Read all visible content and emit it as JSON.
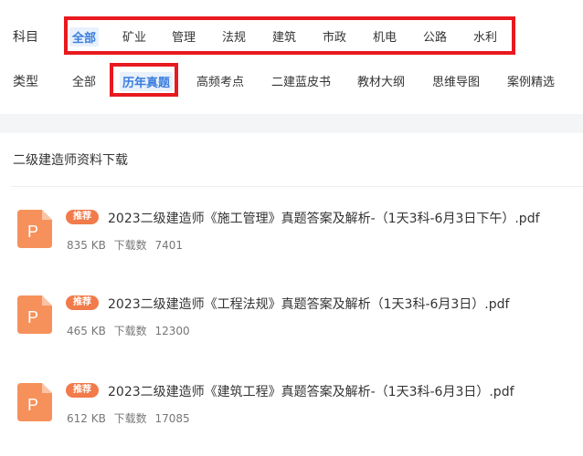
{
  "subject_filter": {
    "label": "科目",
    "options": [
      "全部",
      "矿业",
      "管理",
      "法规",
      "建筑",
      "市政",
      "机电",
      "公路",
      "水利"
    ],
    "selected": "全部"
  },
  "type_filter": {
    "label": "类型",
    "options": [
      "全部",
      "历年真题",
      "高频考点",
      "二建蓝皮书",
      "教材大纲",
      "思维导图",
      "案例精选"
    ],
    "selected": "历年真题"
  },
  "section": {
    "title": "二级建造师资料下载"
  },
  "files": [
    {
      "badge": "推荐",
      "title": "2023二级建造师《施工管理》真题答案及解析-（1天3科-6月3日下午）.pdf",
      "size": "835 KB",
      "downloads_label": "下载数",
      "downloads": "7401",
      "icon_letter": "P"
    },
    {
      "badge": "推荐",
      "title": "2023二级建造师《工程法规》真题答案及解析（1天3科-6月3日）.pdf",
      "size": "465 KB",
      "downloads_label": "下载数",
      "downloads": "12300",
      "icon_letter": "P"
    },
    {
      "badge": "推荐",
      "title": "2023二级建造师《建筑工程》真题答案及解析-（1天3科-6月3日）.pdf",
      "size": "612 KB",
      "downloads_label": "下载数",
      "downloads": "17085",
      "icon_letter": "P"
    }
  ],
  "colors": {
    "accent": "#3b7ddd",
    "highlight": "#e8191f",
    "badge": "#f17b4a",
    "icon": "#f6915c"
  }
}
